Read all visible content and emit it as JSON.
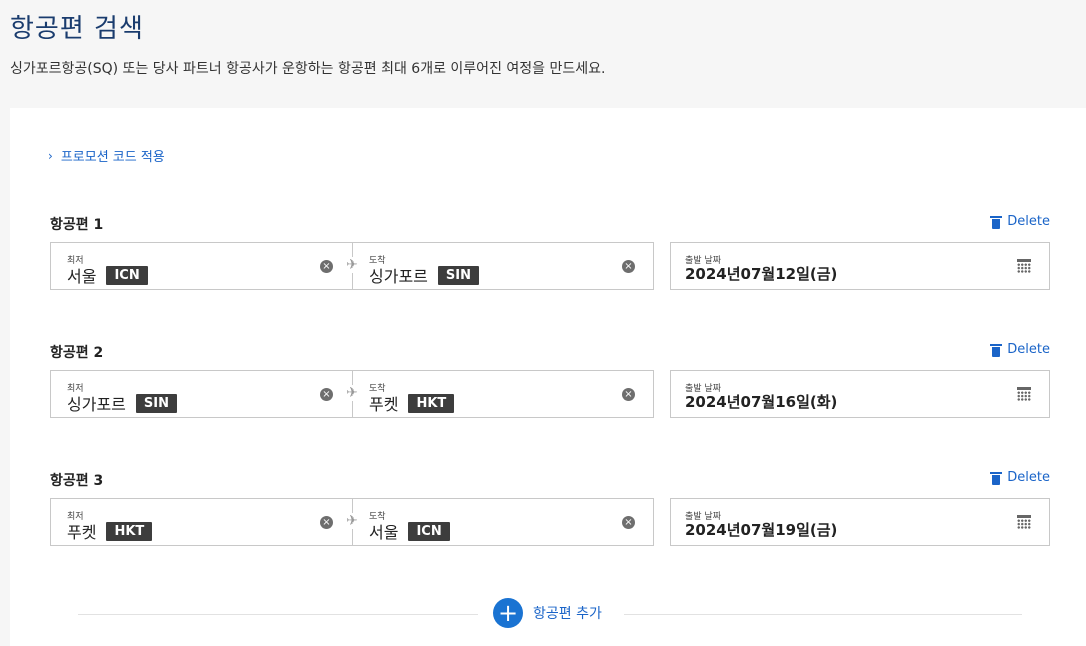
{
  "header": {
    "title": "항공편 검색",
    "subtitle": "싱가포르항공(SQ) 또는 당사 파트너 항공사가 운항하는 항공편 최대 6개로 이루어진 여정을 만드세요."
  },
  "promo": {
    "label": "프로모션 코드 적용"
  },
  "delete_label": "Delete",
  "from_label": "최저",
  "to_label": "도착",
  "date_label": "출발 날짜",
  "flights": [
    {
      "label": "항공편 1",
      "from_city": "서울",
      "from_code": "ICN",
      "to_city": "싱가포르",
      "to_code": "SIN",
      "date": "2024년07월12일(금)"
    },
    {
      "label": "항공편 2",
      "from_city": "싱가포르",
      "from_code": "SIN",
      "to_city": "푸켓",
      "to_code": "HKT",
      "date": "2024년07월16일(화)"
    },
    {
      "label": "항공편 3",
      "from_city": "푸켓",
      "from_code": "HKT",
      "to_city": "서울",
      "to_code": "ICN",
      "date": "2024년07월19일(금)"
    }
  ],
  "add_flight": {
    "label": "항공편 추가"
  },
  "icons": {
    "clear": "×",
    "plane": "✈",
    "chevron": "›",
    "plus": "+"
  },
  "colors": {
    "accent": "#1a64c8",
    "title": "#1a3c6e",
    "code_bg": "#3d3d3d"
  }
}
